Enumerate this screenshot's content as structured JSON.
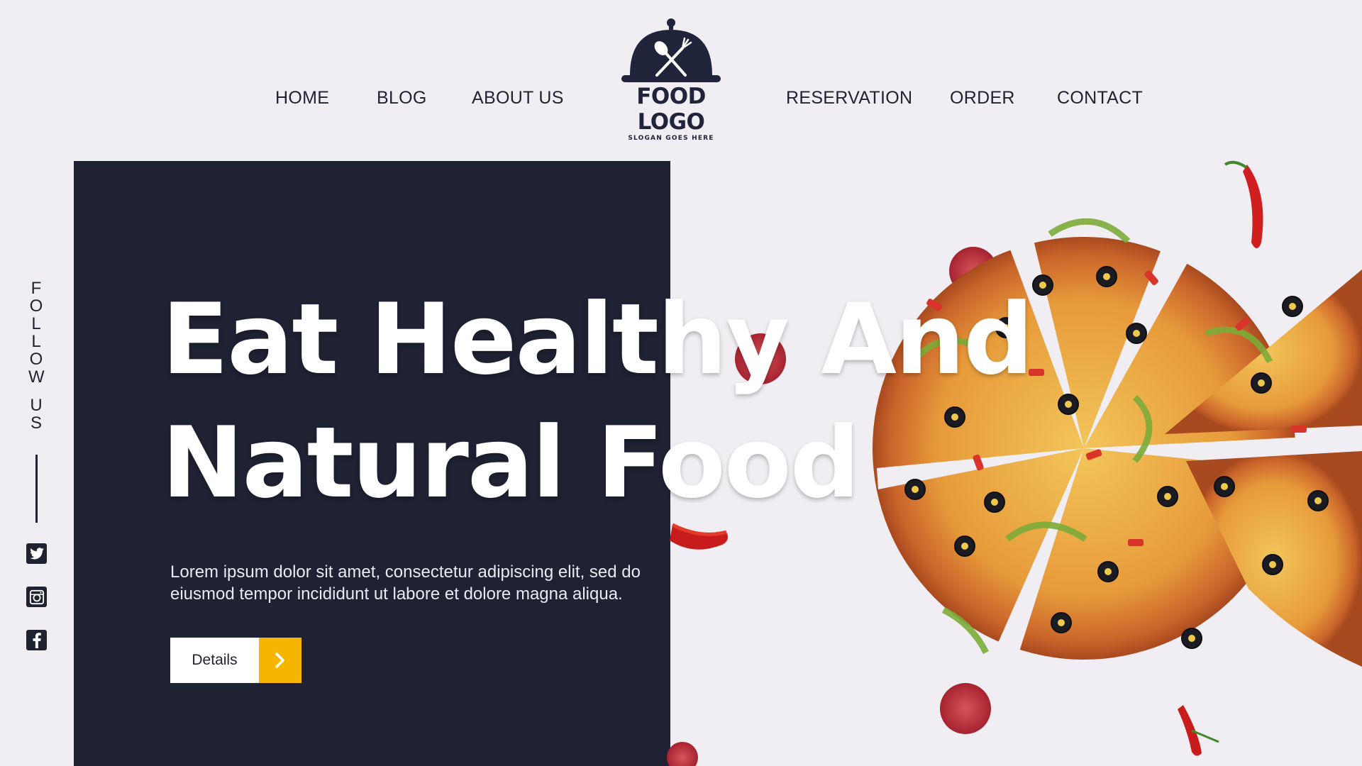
{
  "nav": {
    "left": [
      "HOME",
      "BLOG",
      "ABOUT US"
    ],
    "right": [
      "RESERVATION",
      "ORDER",
      "CONTACT"
    ]
  },
  "logo": {
    "title": "FOOD LOGO",
    "slogan": "SLOGAN GOES HERE"
  },
  "hero": {
    "headline_line1": "Eat Healthy And",
    "headline_line2": "Natural Food",
    "description": "Lorem ipsum dolor sit amet, consectetur adipiscing elit, sed do eiusmod tempor incididunt ut labore et dolore magna aliqua.",
    "button_label": "Details"
  },
  "follow": {
    "letters": [
      "F",
      "O",
      "L",
      "L",
      "O",
      "W",
      "",
      "U",
      "S"
    ]
  },
  "social": [
    "twitter-icon",
    "instagram-icon",
    "facebook-icon"
  ],
  "colors": {
    "background": "#f0eef2",
    "panel": "#1f2233",
    "accent": "#f7b500",
    "text_dark": "#1f2230"
  }
}
